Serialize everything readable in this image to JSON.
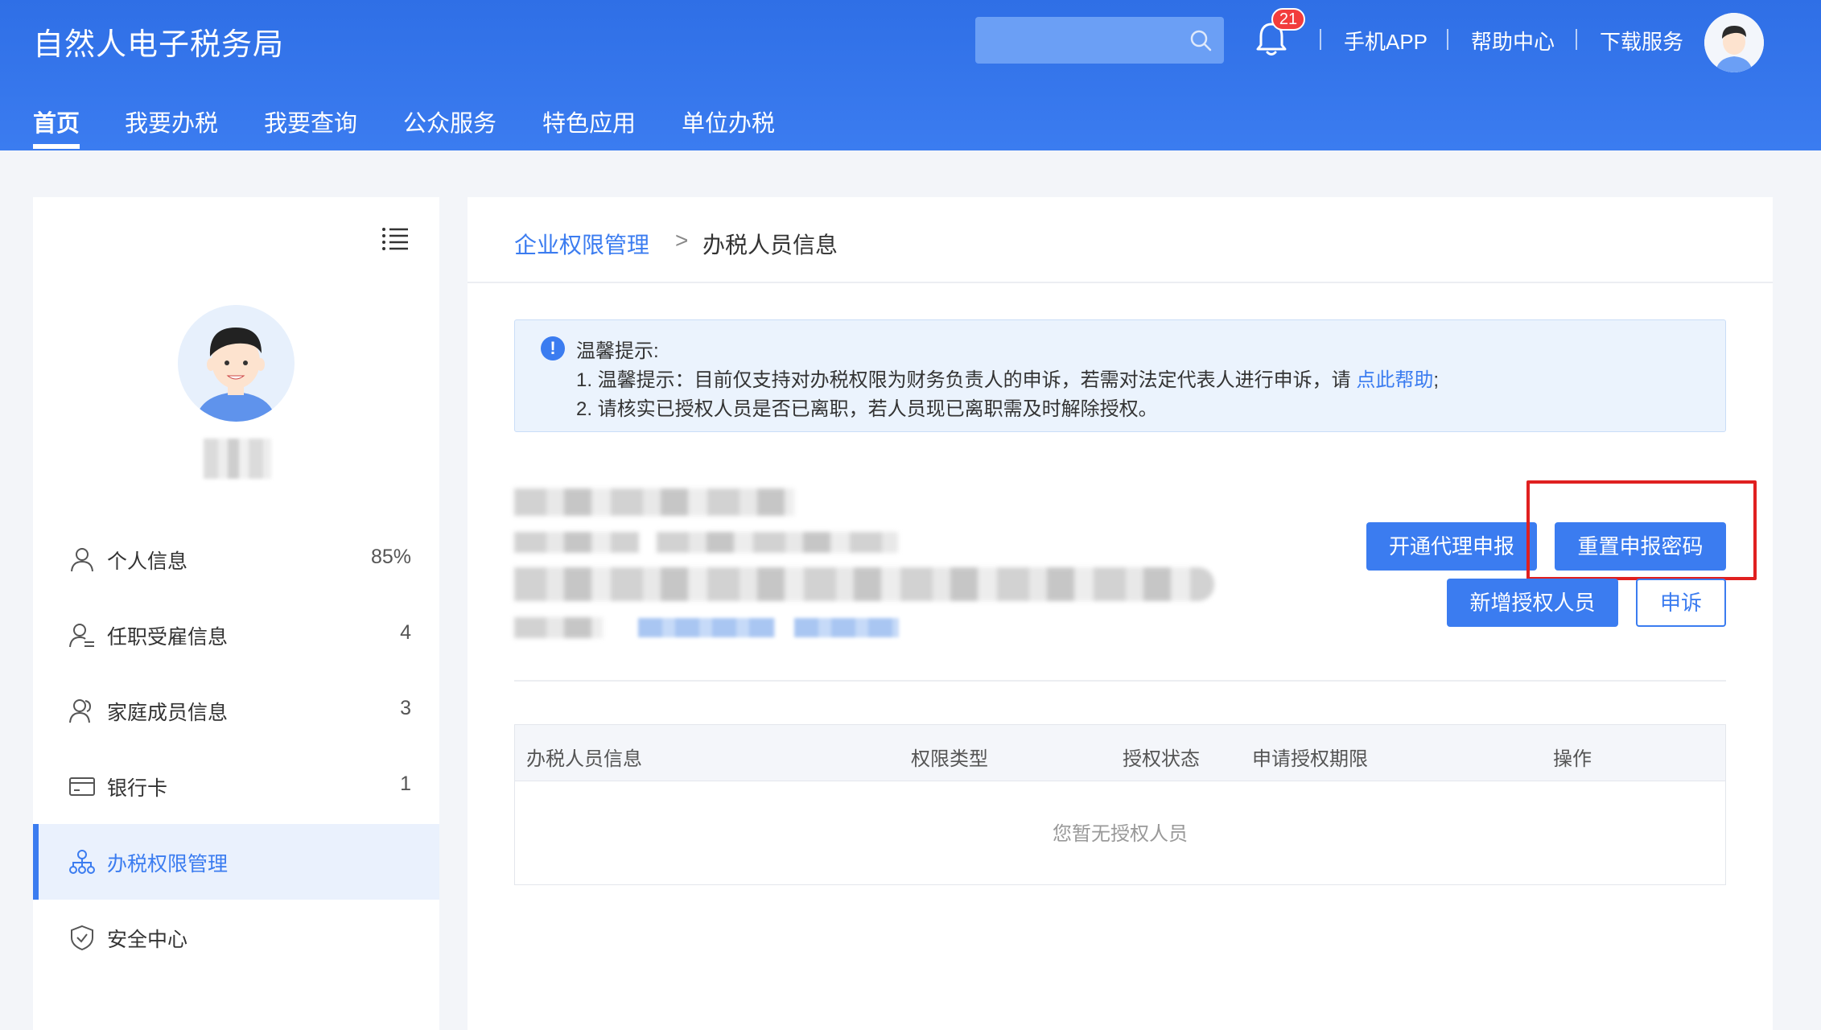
{
  "header": {
    "title": "自然人电子税务局",
    "search": {
      "value": "",
      "placeholder": ""
    },
    "notification_count": "21",
    "links": [
      "手机APP",
      "帮助中心",
      "下载服务"
    ],
    "accent_color": "#3b7cf0"
  },
  "nav": {
    "items": [
      "首页",
      "我要办税",
      "我要查询",
      "公众服务",
      "特色应用",
      "单位办税"
    ],
    "active": "首页"
  },
  "sidebar": {
    "items": [
      {
        "label": "个人信息",
        "count": "85%",
        "icon": "user-icon"
      },
      {
        "label": "任职受雇信息",
        "count": "4",
        "icon": "employment-icon"
      },
      {
        "label": "家庭成员信息",
        "count": "3",
        "icon": "family-icon"
      },
      {
        "label": "银行卡",
        "count": "1",
        "icon": "bank-card-icon"
      },
      {
        "label": "办税权限管理",
        "count": "",
        "icon": "org-chart-icon",
        "active": true
      },
      {
        "label": "安全中心",
        "count": "",
        "icon": "shield-icon"
      }
    ]
  },
  "breadcrumb": {
    "parent": "企业权限管理",
    "separator": ">",
    "current": "办税人员信息"
  },
  "notice": {
    "title": "温馨提示:",
    "line1_prefix": "1. 温馨提示：目前仅支持对办税权限为财务负责人的申诉，若需对法定代表人进行申诉，请 ",
    "line1_link": "点此帮助",
    "line1_suffix": ";",
    "line2": "2. 请核实已授权人员是否已离职，若人员现已离职需及时解除授权。"
  },
  "actions": {
    "open_agent": "开通代理申报",
    "reset_password": "重置申报密码",
    "add_person": "新增授权人员",
    "appeal": "申诉"
  },
  "table": {
    "columns": [
      "办税人员信息",
      "权限类型",
      "授权状态",
      "申请授权期限",
      "操作"
    ],
    "empty_text": "您暂无授权人员"
  }
}
